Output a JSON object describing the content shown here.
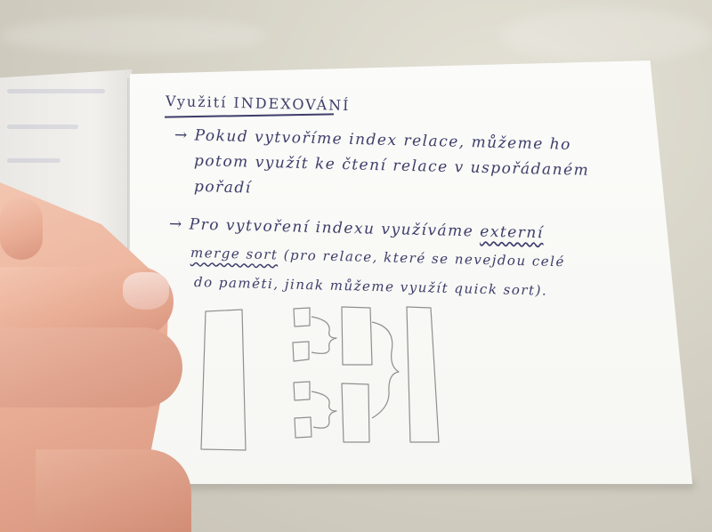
{
  "notebook": {
    "title": "Využití INDEXOVÁNÍ",
    "bullet1": {
      "line1": "→ Pokud vytvoříme index relace, můžeme ho",
      "line2": "potom využít ke čtení relace v uspořádaném",
      "line3": "pořadí"
    },
    "bullet2": {
      "line1_a": "→ Pro vytvoření indexu využíváme ",
      "line1_b": "externí",
      "line2_a": "merge sort",
      "line2_b": " (pro relace, které se nevejdou celé",
      "line3": "do paměti, jinak můžeme využít quick sort)."
    }
  },
  "colors": {
    "ink": "#3e3d6a",
    "pencil": "#8f8f8f",
    "paper": "#f8f8f5",
    "fabric": "#d6d2c6",
    "skin": "#e9ad95"
  }
}
